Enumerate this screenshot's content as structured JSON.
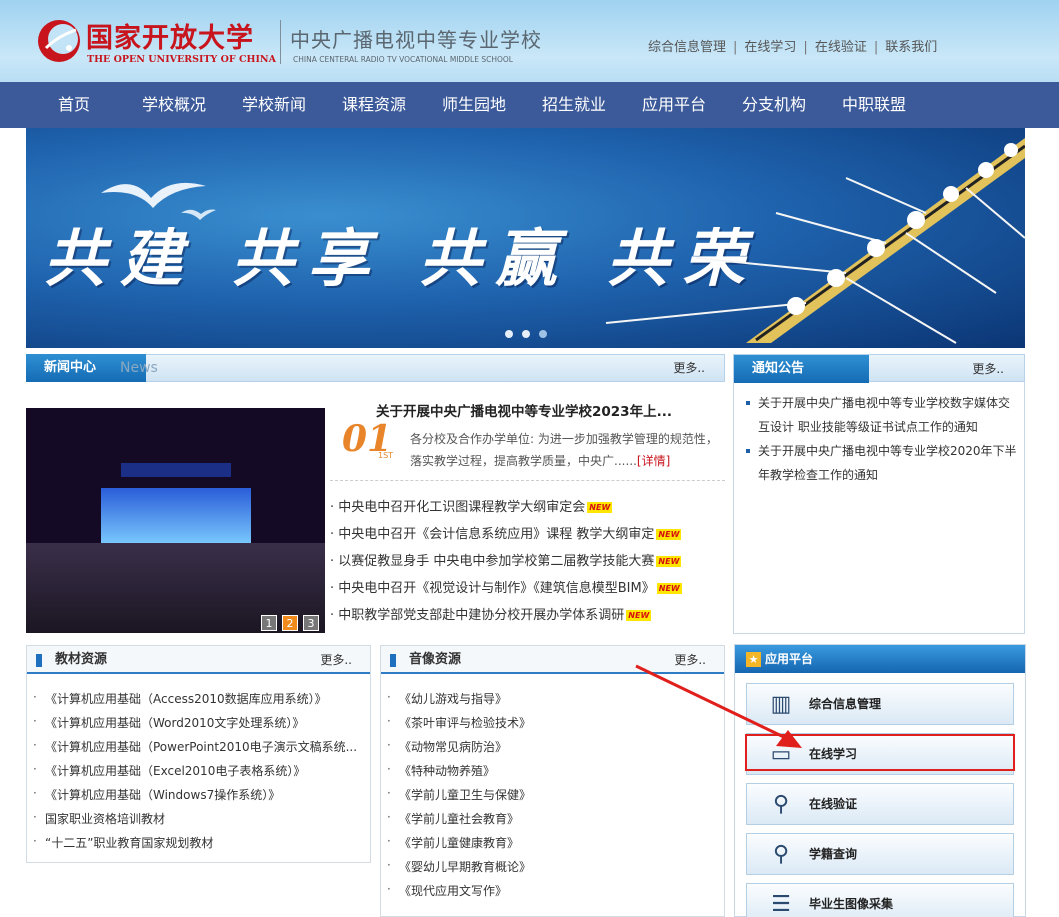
{
  "header": {
    "logo_cn": "国家开放大学",
    "logo_en": "THE OPEN UNIVERSITY OF CHINA",
    "school_cn": "中央广播电视中等专业学校",
    "school_en": "CHINA CENTERAL RADIO TV VOCATIONAL MIDDLE SCHOOL",
    "links": [
      "综合信息管理",
      "在线学习",
      "在线验证",
      "联系我们"
    ],
    "separator": "|"
  },
  "nav": [
    "首页",
    "学校概况",
    "学校新闻",
    "课程资源",
    "师生园地",
    "招生就业",
    "应用平台",
    "分支机构",
    "中职联盟"
  ],
  "banner": {
    "slogan": "共建 共享 共赢 共荣"
  },
  "news": {
    "title": "新闻中心",
    "title_en": "News",
    "more": "更多..",
    "feature_title": "关于开展中央广播电视中等专业学校2023年上...",
    "feature_date": "01",
    "feature_date_sub": "1ST",
    "feature_body": "各分校及合作办学单位: 为进一步加强教学管理的规范性，落实教学过程，提高教学质量，中央广......",
    "feature_detail": "[详情]",
    "pages": [
      "1",
      "2",
      "3"
    ],
    "new_badge": "NEW",
    "items": [
      "中央电中召开化工识图课程教学大纲审定会",
      "中央电中召开《会计信息系统应用》课程 教学大纲审定",
      "以赛促教显身手 中央电中参加学校第二届教学技能大赛",
      "中央电中召开《视觉设计与制作》《建筑信息模型BIM》",
      "中职教学部党支部赴中建协分校开展办学体系调研"
    ]
  },
  "notices": {
    "title": "通知公告",
    "more": "更多..",
    "items": [
      "关于开展中央广播电视中等专业学校数字媒体交互设计 职业技能等级证书试点工作的通知",
      "关于开展中央广播电视中等专业学校2020年下半年教学检查工作的通知"
    ]
  },
  "textbooks": {
    "title": "教材资源",
    "more": "更多..",
    "items": [
      "《计算机应用基础（Access2010数据库应用系统）》",
      "《计算机应用基础（Word2010文字处理系统）》",
      "《计算机应用基础（PowerPoint2010电子演示文稿系统...",
      "《计算机应用基础（Excel2010电子表格系统）》",
      "《计算机应用基础（Windows7操作系统）》",
      "国家职业资格培训教材",
      "“十二五”职业教育国家规划教材"
    ]
  },
  "media": {
    "title": "音像资源",
    "more": "更多..",
    "items": [
      "《幼儿游戏与指导》",
      "《茶叶审评与检验技术》",
      "《动物常见病防治》",
      "《特种动物养殖》",
      "《学前儿童卫生与保健》",
      "《学前儿童社会教育》",
      "《学前儿童健康教育》",
      "《婴幼儿早期教育概论》",
      "《现代应用文写作》"
    ]
  },
  "apps": {
    "title": "应用平台",
    "buttons": [
      {
        "label": "综合信息管理",
        "icon": "books-icon"
      },
      {
        "label": "在线学习",
        "icon": "monitor-icon"
      },
      {
        "label": "在线验证",
        "icon": "magnifier-icon"
      },
      {
        "label": "学籍查询",
        "icon": "magnifier-icon"
      },
      {
        "label": "毕业生图像采集",
        "icon": "checklist-icon"
      }
    ]
  },
  "colors": {
    "nav": "#3c5a9a",
    "brand_red": "#c8141c",
    "highlight": "#e0201c",
    "accent_blue": "#1f6fbf"
  }
}
